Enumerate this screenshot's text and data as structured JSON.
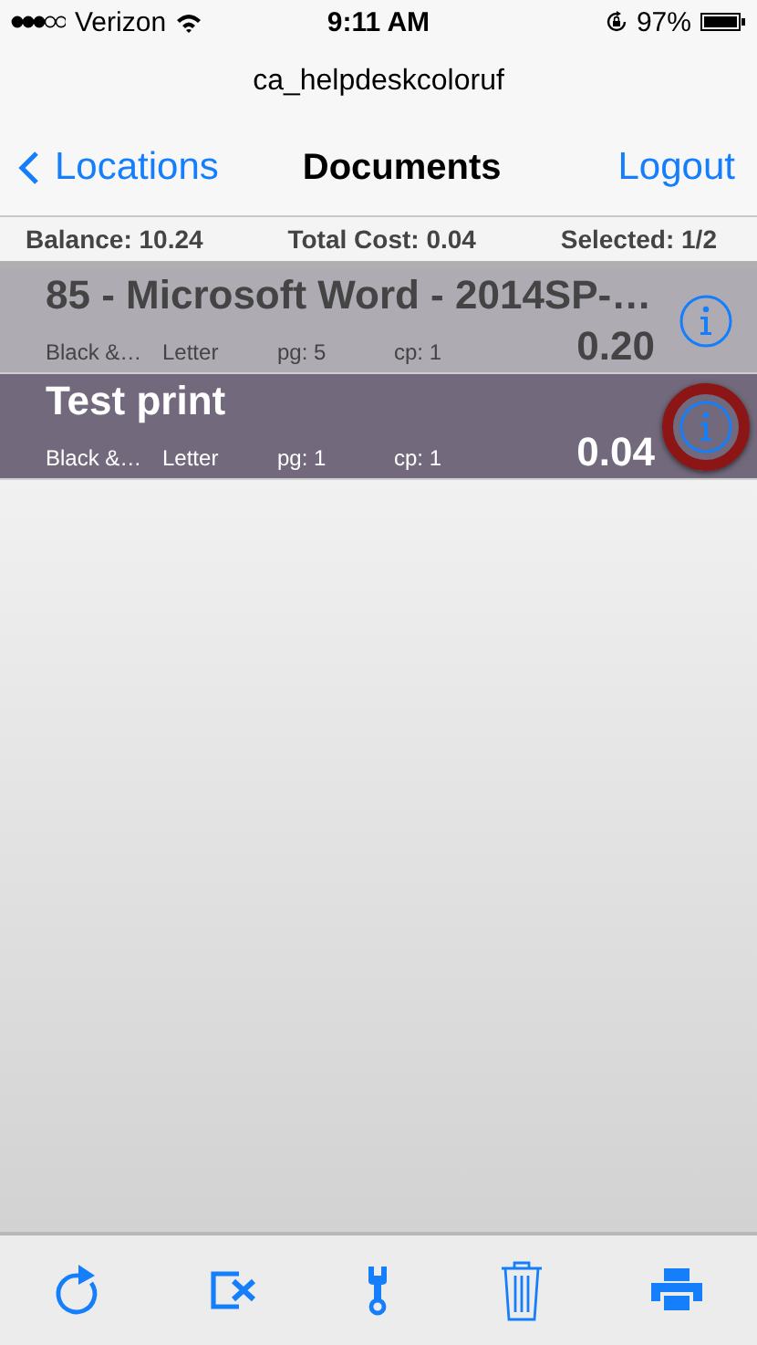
{
  "status_bar": {
    "carrier": "Verizon",
    "time": "9:11 AM",
    "battery": "97%"
  },
  "account": "ca_helpdeskcoloruf",
  "nav": {
    "back": "Locations",
    "title": "Documents",
    "action": "Logout"
  },
  "summary": {
    "balance": "Balance: 10.24",
    "total_cost": "Total Cost: 0.04",
    "selected": "Selected: 1/2"
  },
  "documents": [
    {
      "title": "85 - Microsoft Word - 2014SP-…",
      "color_mode": "Black &…",
      "paper": "Letter",
      "pages": "pg: 5",
      "copies": "cp: 1",
      "cost": "0.20",
      "selected": false,
      "circled": false
    },
    {
      "title": "Test print",
      "color_mode": "Black &…",
      "paper": "Letter",
      "pages": "pg: 1",
      "copies": "cp: 1",
      "cost": "0.04",
      "selected": true,
      "circled": true
    }
  ],
  "toolbar": [
    {
      "kind": "refresh"
    },
    {
      "kind": "clear"
    },
    {
      "kind": "settings"
    },
    {
      "kind": "delete"
    },
    {
      "kind": "print"
    }
  ]
}
